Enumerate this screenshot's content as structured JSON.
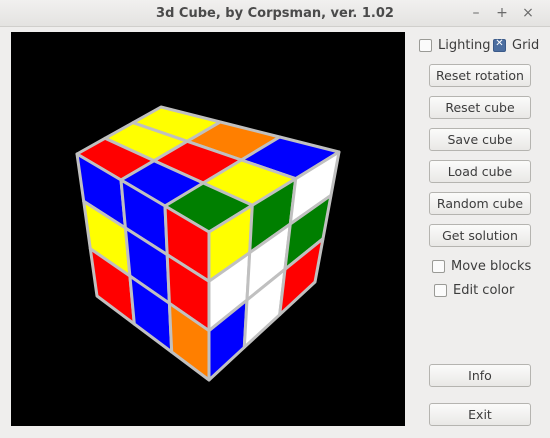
{
  "window": {
    "title": "3d Cube, by Corpsman, ver. 1.02",
    "minimize_glyph": "–",
    "maximize_glyph": "+",
    "close_glyph": "×"
  },
  "options": {
    "lighting_label": "Lighting",
    "lighting_checked": false,
    "grid_label": "Grid",
    "grid_checked": true,
    "move_blocks_label": "Move blocks",
    "move_blocks_checked": false,
    "edit_color_label": "Edit color",
    "edit_color_checked": false
  },
  "buttons": {
    "reset_rotation": "Reset rotation",
    "reset_cube": "Reset cube",
    "save_cube": "Save cube",
    "load_cube": "Load cube",
    "random_cube": "Random cube",
    "get_solution": "Get solution",
    "info": "Info",
    "exit": "Exit"
  },
  "cube": {
    "colors": {
      "Y": "#ffff00",
      "R": "#ff0000",
      "B": "#0000ff",
      "G": "#007f00",
      "W": "#ffffff",
      "O": "#ff7f00"
    },
    "grid_color": "#c0c0c0",
    "top_face": [
      [
        "Y",
        "O",
        "B"
      ],
      [
        "Y",
        "R",
        "Y"
      ],
      [
        "R",
        "B",
        "G"
      ]
    ],
    "left_face": [
      [
        "B",
        "B",
        "R"
      ],
      [
        "Y",
        "B",
        "R"
      ],
      [
        "R",
        "B",
        "O"
      ]
    ],
    "front_face": [
      [
        "Y",
        "G",
        "W"
      ],
      [
        "W",
        "W",
        "G"
      ],
      [
        "B",
        "W",
        "R"
      ]
    ]
  }
}
